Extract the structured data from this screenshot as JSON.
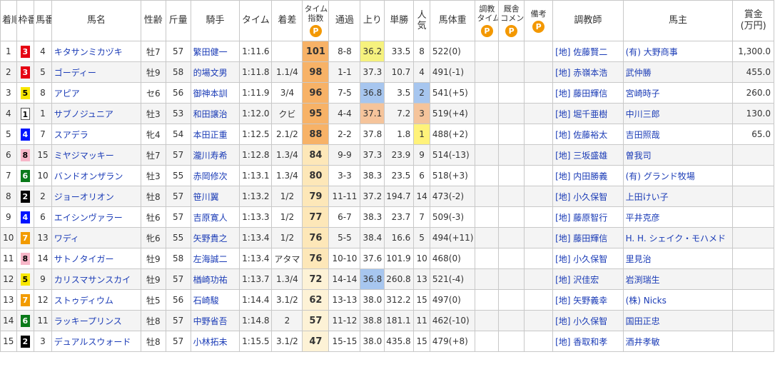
{
  "headers": {
    "rank": "着順",
    "waku": "枠番",
    "umaban": "馬番",
    "name": "馬名",
    "sexage": "性齢",
    "weight": "斤量",
    "jockey": "騎手",
    "time": "タイム",
    "margin": "着差",
    "index_top": "タイム",
    "index_bottom": "指数",
    "passing": "通過",
    "last3f": "上り",
    "odds": "単勝",
    "pop": "人気",
    "bodyweight": "馬体重",
    "chokyo_top": "調教",
    "chokyo_bottom": "タイム",
    "comment_top": "厩舎",
    "comment_bottom": "コメント",
    "remark": "備考",
    "trainer": "調教師",
    "owner": "馬主",
    "prize_top": "賞金",
    "prize_bottom": "(万円)",
    "premium_icon": "P"
  },
  "colors": {
    "link": "#1a3bb6",
    "index_gold": "#f7b267",
    "index_light": "#fde7b8",
    "index_pale": "#fdf2d6",
    "last3f_1st": "#f6f27e",
    "last3f_2nd": "#a7c6ef",
    "last3f_3rd": "#f5c49b",
    "pop_1st": "#fff27a",
    "pop_2nd": "#a7c6ef",
    "pop_3rd": "#f5c49b",
    "premium_icon": "#f39800"
  },
  "rows": [
    {
      "rank": "1",
      "waku": "3",
      "umaban": "4",
      "name": "キタサンミカヅキ",
      "sexage": "牡7",
      "weight": "57",
      "jockey": "繁田健一",
      "time": "1:11.6",
      "margin": "",
      "index": "101",
      "passing": "8-8",
      "last3f": "36.2",
      "odds": "33.5",
      "pop": "8",
      "bodyweight": "522(0)",
      "trainer": "[地] 佐藤賢二",
      "owner": "(有) 大野商事",
      "prize": "1,300.0"
    },
    {
      "rank": "2",
      "waku": "3",
      "umaban": "5",
      "name": "ゴーディー",
      "sexage": "牡9",
      "weight": "58",
      "jockey": "的場文男",
      "time": "1:11.8",
      "margin": "1.1/4",
      "index": "98",
      "passing": "1-1",
      "last3f": "37.3",
      "odds": "10.7",
      "pop": "4",
      "bodyweight": "491(-1)",
      "trainer": "[地] 赤嶺本浩",
      "owner": "武仲勝",
      "prize": "455.0"
    },
    {
      "rank": "3",
      "waku": "5",
      "umaban": "8",
      "name": "アピア",
      "sexage": "セ6",
      "weight": "56",
      "jockey": "御神本訓",
      "time": "1:11.9",
      "margin": "3/4",
      "index": "96",
      "passing": "7-5",
      "last3f": "36.8",
      "odds": "3.5",
      "pop": "2",
      "bodyweight": "541(+5)",
      "trainer": "[地] 藤田輝信",
      "owner": "宮崎時子",
      "prize": "260.0"
    },
    {
      "rank": "4",
      "waku": "1",
      "umaban": "1",
      "name": "サブノジュニア",
      "sexage": "牡3",
      "weight": "53",
      "jockey": "和田譲治",
      "time": "1:12.0",
      "margin": "クビ",
      "index": "95",
      "passing": "4-4",
      "last3f": "37.1",
      "odds": "7.2",
      "pop": "3",
      "bodyweight": "519(+4)",
      "trainer": "[地] 堀千亜樹",
      "owner": "中川三郎",
      "prize": "130.0"
    },
    {
      "rank": "5",
      "waku": "4",
      "umaban": "7",
      "name": "スアデラ",
      "sexage": "牝4",
      "weight": "54",
      "jockey": "本田正重",
      "time": "1:12.5",
      "margin": "2.1/2",
      "index": "88",
      "passing": "2-2",
      "last3f": "37.8",
      "odds": "1.8",
      "pop": "1",
      "bodyweight": "488(+2)",
      "trainer": "[地] 佐藤裕太",
      "owner": "吉田照哉",
      "prize": "65.0"
    },
    {
      "rank": "6",
      "waku": "8",
      "umaban": "15",
      "name": "ミヤジマッキー",
      "sexage": "牡7",
      "weight": "57",
      "jockey": "瀧川寿希",
      "time": "1:12.8",
      "margin": "1.3/4",
      "index": "84",
      "passing": "9-9",
      "last3f": "37.3",
      "odds": "23.9",
      "pop": "9",
      "bodyweight": "514(-13)",
      "trainer": "[地] 三坂盛雄",
      "owner": "曽我司",
      "prize": ""
    },
    {
      "rank": "7",
      "waku": "6",
      "umaban": "10",
      "name": "バンドオンザラン",
      "sexage": "牡3",
      "weight": "55",
      "jockey": "赤岡修次",
      "time": "1:13.1",
      "margin": "1.3/4",
      "index": "80",
      "passing": "3-3",
      "last3f": "38.3",
      "odds": "23.5",
      "pop": "6",
      "bodyweight": "518(+3)",
      "trainer": "[地] 内田勝義",
      "owner": "(有) グランド牧場",
      "prize": ""
    },
    {
      "rank": "8",
      "waku": "2",
      "umaban": "2",
      "name": "ジョーオリオン",
      "sexage": "牡8",
      "weight": "57",
      "jockey": "笹川翼",
      "time": "1:13.2",
      "margin": "1/2",
      "index": "79",
      "passing": "11-11",
      "last3f": "37.2",
      "odds": "194.7",
      "pop": "14",
      "bodyweight": "473(-2)",
      "trainer": "[地] 小久保智",
      "owner": "上田けい子",
      "prize": ""
    },
    {
      "rank": "9",
      "waku": "4",
      "umaban": "6",
      "name": "エイシンヴァラー",
      "sexage": "牡6",
      "weight": "57",
      "jockey": "吉原寛人",
      "time": "1:13.3",
      "margin": "1/2",
      "index": "77",
      "passing": "6-7",
      "last3f": "38.3",
      "odds": "23.7",
      "pop": "7",
      "bodyweight": "509(-3)",
      "trainer": "[地] 藤原智行",
      "owner": "平井克彦",
      "prize": ""
    },
    {
      "rank": "10",
      "waku": "7",
      "umaban": "13",
      "name": "ワディ",
      "sexage": "牝6",
      "weight": "55",
      "jockey": "矢野貴之",
      "time": "1:13.4",
      "margin": "1/2",
      "index": "76",
      "passing": "5-5",
      "last3f": "38.4",
      "odds": "16.6",
      "pop": "5",
      "bodyweight": "494(+11)",
      "trainer": "[地] 藤田輝信",
      "owner": "H. H. シェイク・モハメド",
      "prize": ""
    },
    {
      "rank": "11",
      "waku": "8",
      "umaban": "14",
      "name": "サトノタイガー",
      "sexage": "牡9",
      "weight": "58",
      "jockey": "左海誠二",
      "time": "1:13.4",
      "margin": "アタマ",
      "index": "76",
      "passing": "10-10",
      "last3f": "37.6",
      "odds": "101.9",
      "pop": "10",
      "bodyweight": "468(0)",
      "trainer": "[地] 小久保智",
      "owner": "里見治",
      "prize": ""
    },
    {
      "rank": "12",
      "waku": "5",
      "umaban": "9",
      "name": "カリスマサンスカイ",
      "sexage": "牡9",
      "weight": "57",
      "jockey": "楢崎功祐",
      "time": "1:13.7",
      "margin": "1.3/4",
      "index": "72",
      "passing": "14-14",
      "last3f": "36.8",
      "odds": "260.8",
      "pop": "13",
      "bodyweight": "521(-4)",
      "trainer": "[地] 沢佳宏",
      "owner": "岩渕瑞生",
      "prize": ""
    },
    {
      "rank": "13",
      "waku": "7",
      "umaban": "12",
      "name": "ストゥディウム",
      "sexage": "牡5",
      "weight": "56",
      "jockey": "石崎駿",
      "time": "1:14.4",
      "margin": "3.1/2",
      "index": "62",
      "passing": "13-13",
      "last3f": "38.0",
      "odds": "312.2",
      "pop": "15",
      "bodyweight": "497(0)",
      "trainer": "[地] 矢野義幸",
      "owner": "(株) Nicks",
      "prize": ""
    },
    {
      "rank": "14",
      "waku": "6",
      "umaban": "11",
      "name": "ラッキープリンス",
      "sexage": "牡8",
      "weight": "57",
      "jockey": "中野省吾",
      "time": "1:14.8",
      "margin": "2",
      "index": "57",
      "passing": "11-12",
      "last3f": "38.8",
      "odds": "181.1",
      "pop": "11",
      "bodyweight": "462(-10)",
      "trainer": "[地] 小久保智",
      "owner": "国田正忠",
      "prize": ""
    },
    {
      "rank": "15",
      "waku": "2",
      "umaban": "3",
      "name": "デュアルスウォード",
      "sexage": "牡8",
      "weight": "57",
      "jockey": "小林拓未",
      "time": "1:15.5",
      "margin": "3.1/2",
      "index": "47",
      "passing": "15-15",
      "last3f": "38.0",
      "odds": "435.8",
      "pop": "15",
      "bodyweight": "479(+8)",
      "trainer": "[地] 香取和孝",
      "owner": "酒井孝敏",
      "prize": ""
    }
  ]
}
